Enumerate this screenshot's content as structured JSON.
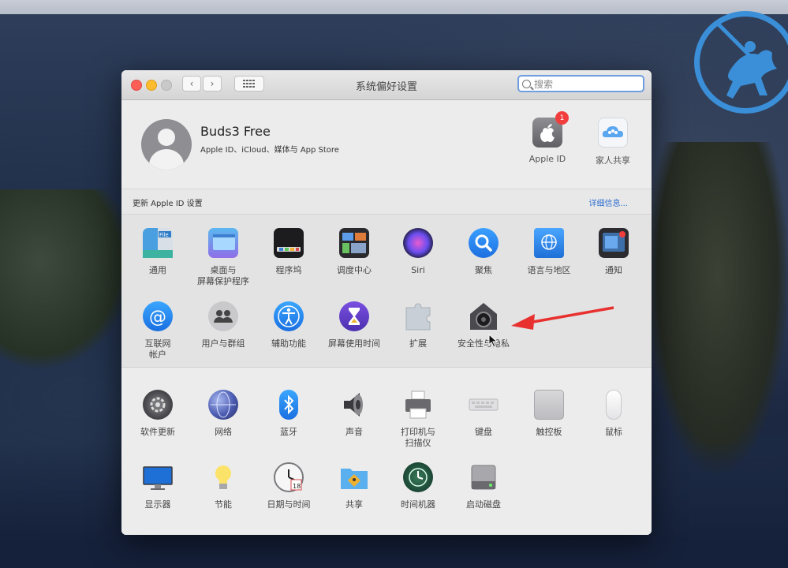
{
  "window": {
    "title": "系统偏好设置",
    "search_placeholder": "搜索"
  },
  "profile": {
    "name": "Buds3 Free",
    "subtitle": "Apple ID、iCloud、媒体与 App Store",
    "apple_id_label": "Apple ID",
    "apple_id_badge": "1",
    "family_label": "家人共享"
  },
  "notice": {
    "text": "更新 Apple ID 设置",
    "link": "详细信息..."
  },
  "prefs_row1": [
    {
      "label": "通用",
      "icon": "general-icon"
    },
    {
      "label": "桌面与\n屏幕保护程序",
      "icon": "desktop-icon"
    },
    {
      "label": "程序坞",
      "icon": "dock-icon"
    },
    {
      "label": "调度中心",
      "icon": "mission-control-icon"
    },
    {
      "label": "Siri",
      "icon": "siri-icon"
    },
    {
      "label": "聚焦",
      "icon": "spotlight-icon"
    },
    {
      "label": "语言与地区",
      "icon": "language-icon"
    },
    {
      "label": "通知",
      "icon": "notifications-icon"
    }
  ],
  "prefs_row2": [
    {
      "label": "互联网\n帐户",
      "icon": "internet-accounts-icon"
    },
    {
      "label": "用户与群组",
      "icon": "users-icon"
    },
    {
      "label": "辅助功能",
      "icon": "accessibility-icon"
    },
    {
      "label": "屏幕使用时间",
      "icon": "screen-time-icon"
    },
    {
      "label": "扩展",
      "icon": "extensions-icon"
    },
    {
      "label": "安全性与隐私",
      "icon": "security-icon"
    }
  ],
  "prefs_row3": [
    {
      "label": "软件更新",
      "icon": "software-update-icon"
    },
    {
      "label": "网络",
      "icon": "network-icon"
    },
    {
      "label": "蓝牙",
      "icon": "bluetooth-icon"
    },
    {
      "label": "声音",
      "icon": "sound-icon"
    },
    {
      "label": "打印机与\n扫描仪",
      "icon": "printer-icon"
    },
    {
      "label": "键盘",
      "icon": "keyboard-icon"
    },
    {
      "label": "触控板",
      "icon": "trackpad-icon"
    },
    {
      "label": "鼠标",
      "icon": "mouse-icon"
    }
  ],
  "prefs_row4": [
    {
      "label": "显示器",
      "icon": "display-icon"
    },
    {
      "label": "节能",
      "icon": "energy-icon"
    },
    {
      "label": "日期与时间",
      "icon": "date-time-icon"
    },
    {
      "label": "共享",
      "icon": "sharing-icon"
    },
    {
      "label": "时间机器",
      "icon": "time-machine-icon"
    },
    {
      "label": "启动磁盘",
      "icon": "startup-disk-icon"
    }
  ],
  "colors": {
    "accent": "#2f6fd0",
    "annotation_arrow": "#e8312f",
    "badge": "#f23d3d"
  }
}
